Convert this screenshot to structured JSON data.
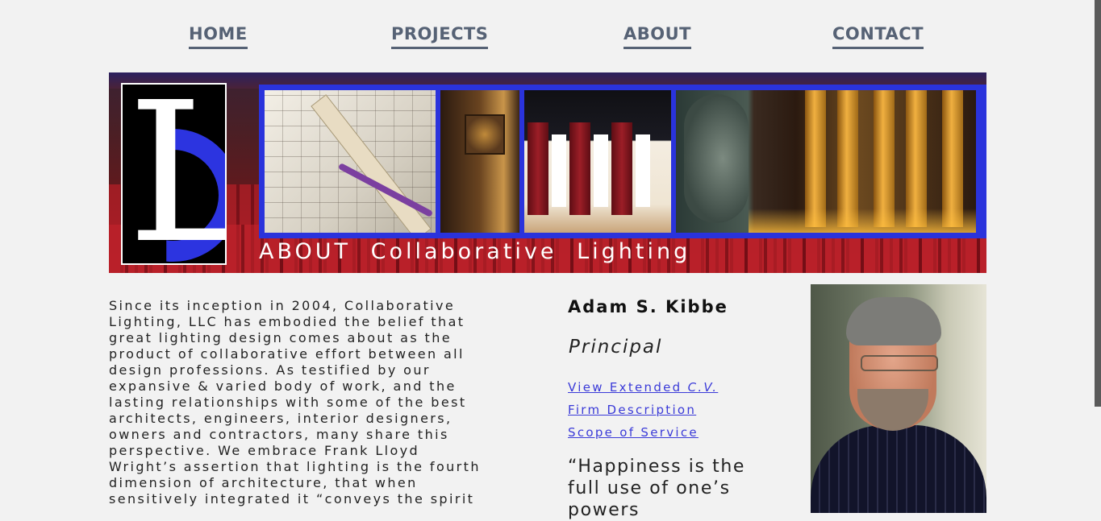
{
  "nav": {
    "items": [
      {
        "label": "HOME"
      },
      {
        "label": "PROJECTS"
      },
      {
        "label": "ABOUT"
      },
      {
        "label": "CONTACT"
      }
    ]
  },
  "banner": {
    "logo_letter": "L",
    "title": "ABOUT  Collaborative  Lighting",
    "accent_color": "#2a33dc"
  },
  "intro": {
    "text": "Since its inception in 2004, Collaborative\nLighting, LLC has embodied the belief that\ngreat lighting design comes about as the\nproduct of collaborative effort between all\ndesign professions. As testified by our\nexpansive & varied body of work, and the\nlasting relationships with some of the best\narchitects, engineers, interior designers,\nowners and contractors, many share this\nperspective. We embrace Frank Lloyd\nWright’s assertion that lighting is the fourth\ndimension of architecture, that when\nsensitively integrated it “conveys the spirit"
  },
  "profile": {
    "name": "Adam S. Kibbe",
    "role": "Principal",
    "links": {
      "cv_prefix": "View Extended ",
      "cv_suffix": "C.V.",
      "firm": "Firm Description",
      "scope": "Scope of Service"
    },
    "quote": "“Happiness is the full use of one’s powers"
  }
}
